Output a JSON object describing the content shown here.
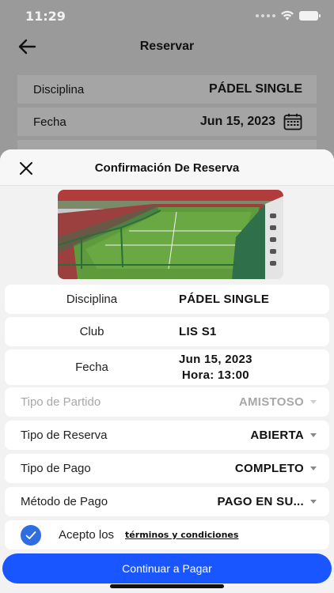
{
  "status": {
    "time": "11:29"
  },
  "background": {
    "title": "Reservar",
    "rows": [
      {
        "label": "Disciplina",
        "value": "PÁDEL SINGLE"
      },
      {
        "label": "Fecha",
        "value": "Jun 15, 2023"
      }
    ]
  },
  "modal": {
    "title": "Confirmación De Reserva",
    "image_alt": "padel-court-photo",
    "info": [
      {
        "label": "Disciplina",
        "value": "PÁDEL SINGLE"
      },
      {
        "label": "Club",
        "value": "LIS S1"
      },
      {
        "label": "Fecha",
        "value_line1": "Jun 15, 2023",
        "value_line2": "Hora: 13:00"
      }
    ],
    "selects": [
      {
        "label": "Tipo de Partido",
        "value": "AMISTOSO",
        "disabled": true
      },
      {
        "label": "Tipo de Reserva",
        "value": "ABIERTA"
      },
      {
        "label": "Tipo de Pago",
        "value": "COMPLETO"
      },
      {
        "label": "Método de Pago",
        "value": "PAGO EN SU..."
      }
    ],
    "terms": {
      "label": "Acepto los",
      "link": "términos y condiciones",
      "checked": true
    },
    "submit_label": "Continuar a Pagar"
  },
  "colors": {
    "accent": "#1a56ff",
    "check": "#2f6ee0"
  }
}
